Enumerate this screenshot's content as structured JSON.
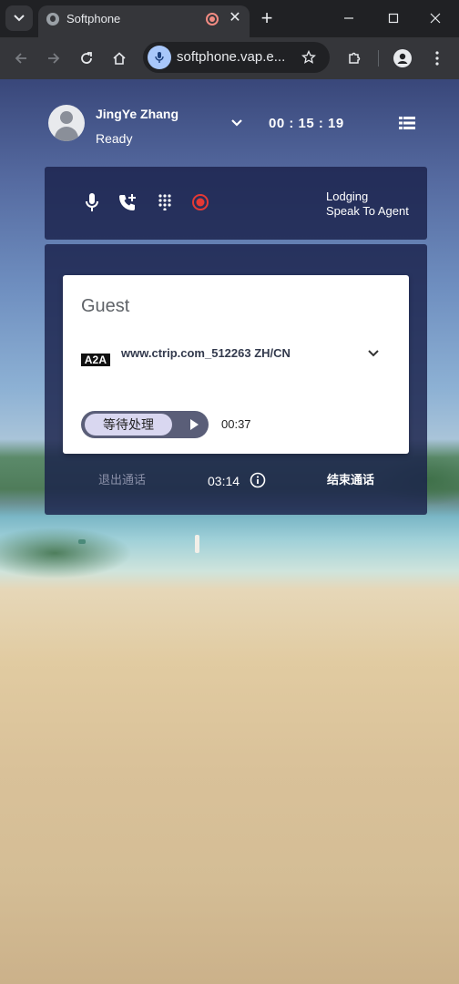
{
  "browser": {
    "tab": {
      "title": "Softphone"
    },
    "address_bar": {
      "url": "softphone.vap.e..."
    }
  },
  "softphone": {
    "agent": {
      "name": "JingYe Zhang",
      "status": "Ready"
    },
    "call_timer": "00 : 15 : 19",
    "queue": {
      "line1": "Lodging",
      "line2": "Speak To Agent"
    },
    "active_call": {
      "caller": "Guest",
      "badge": "A2A",
      "source": "www.ctrip.com_512263 ZH/CN",
      "hold_label": "等待处理",
      "hold_time": "00:37"
    },
    "footer": {
      "exit_call": "退出通话",
      "total_time": "03:14",
      "end_call": "结束通话"
    }
  },
  "colors": {
    "browser_bg": "#202124",
    "panel_bg": "#1a214a",
    "record_red": "#e53935",
    "hold_toggle": "#5a5e78",
    "hold_pill": "#d9d7f0"
  },
  "icons": {
    "mute": "microphone-icon",
    "transfer": "add-call-icon",
    "dialpad": "dialpad-icon",
    "record": "record-icon",
    "menu": "list-menu-icon",
    "info": "info-icon"
  }
}
